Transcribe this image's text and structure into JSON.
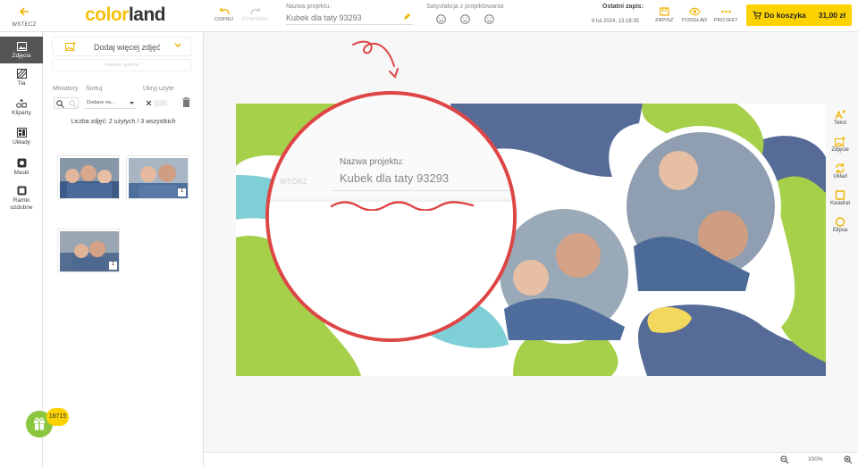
{
  "topbar": {
    "back_label": "WSTECZ",
    "logo_a": "color",
    "logo_b": "land",
    "undo_label": "COFNIJ",
    "redo_label": "POWTÓRZ",
    "project_name_label": "Nazwa projektu:",
    "project_name": "Kubek dla taty 93293",
    "satisfaction_label": "Satysfakcja z projektowania",
    "last_save_label": "Ostatni zapis:",
    "last_save_time": "9 lut 2024, 13:18:35",
    "save_label": "ZAPISZ",
    "preview_label": "PODGLĄD",
    "project_label": "PROJEKT",
    "cart_label": "Do koszyka",
    "cart_price": "31,00 zł"
  },
  "rail": {
    "items": [
      {
        "label": "Zdjęcia"
      },
      {
        "label": "Tła"
      },
      {
        "label": "Kliparty"
      },
      {
        "label": "Układy"
      },
      {
        "label": "Maski"
      },
      {
        "label": "Ramki ozdobne"
      }
    ]
  },
  "panel": {
    "add_photos_label": "Dodaj więcej zdjęć",
    "gallery_label": "Kanwas galeria",
    "thumbs_label": "Miniatury",
    "sort_label": "Sortuj",
    "sort_value": "Dodane na...",
    "hide_used_label": "Ukryj użyte",
    "count_label": "Liczba zdjęć: 2 użytych / 3 wszystkich",
    "photos": [
      {
        "badge": ""
      },
      {
        "badge": "1"
      },
      {
        "badge": "1"
      }
    ],
    "points": "18715"
  },
  "canvas": {
    "magnifier_label": "Nazwa projektu:",
    "magnifier_value": "Kubek dla taty 93293",
    "magnifier_ghost": "WTÓRZ"
  },
  "right_tools": {
    "items": [
      {
        "label": "Tekst"
      },
      {
        "label": "Zdjęcie"
      },
      {
        "label": "Układ"
      },
      {
        "label": "Kwadrat"
      },
      {
        "label": "Elipsa"
      }
    ]
  },
  "bottombar": {
    "zoom": "100%"
  },
  "colors": {
    "accent": "#fdd201",
    "magnifier_ring": "#de4545",
    "lime": "#a6cf4a",
    "teal": "#7fcfd6",
    "navy": "#566b97"
  }
}
